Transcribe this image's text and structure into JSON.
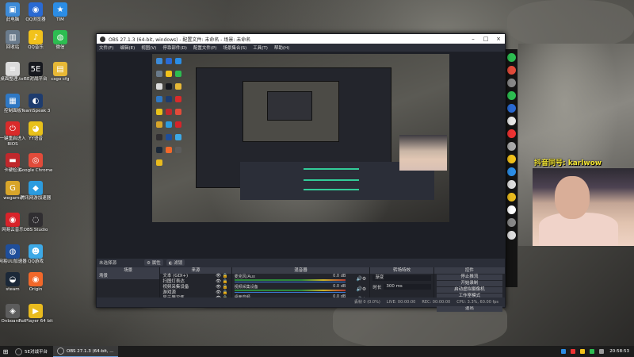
{
  "desktop": {
    "icons": [
      {
        "label": "此电脑",
        "color": "#3d8bd8",
        "glyph": "▣"
      },
      {
        "label": "QQ浏览器",
        "color": "#2a6ad3",
        "glyph": "◉"
      },
      {
        "label": "TIM",
        "color": "#2b8de5",
        "glyph": "★"
      },
      {
        "label": "回收站",
        "color": "#6a7b8c",
        "glyph": "▥"
      },
      {
        "label": "QQ音乐",
        "color": "#f2c21b",
        "glyph": "♪"
      },
      {
        "label": "微信",
        "color": "#2dbd51",
        "glyph": "◍"
      },
      {
        "label": "桌面整理.txt",
        "color": "#dcdcdc",
        "glyph": "≡"
      },
      {
        "label": "5E对战平台",
        "color": "#16181e",
        "glyph": "5E"
      },
      {
        "label": "csgo cfg",
        "color": "#e7b836",
        "glyph": "▤"
      },
      {
        "label": "控制面板",
        "color": "#2f78c4",
        "glyph": "▦"
      },
      {
        "label": "TeamSpeak 3",
        "color": "#1e3c6e",
        "glyph": "◐"
      },
      {
        "label": "一键重启进入BIOS",
        "color": "#d92b2b",
        "glyph": "⏻"
      },
      {
        "label": "YY语音",
        "color": "#e8c11a",
        "glyph": "◕"
      },
      {
        "label": "卡硬检测",
        "color": "#c0282c",
        "glyph": "▬"
      },
      {
        "label": "Google Chrome",
        "color": "#e24b3a",
        "glyph": "◎"
      },
      {
        "label": "wegame",
        "color": "#d8a52a",
        "glyph": "G"
      },
      {
        "label": "腾讯网游加速器",
        "color": "#2c9cdf",
        "glyph": "◆"
      },
      {
        "label": "网易云音乐",
        "color": "#d8232a",
        "glyph": "◉"
      },
      {
        "label": "OBS Studio",
        "color": "#302e31",
        "glyph": "◌"
      },
      {
        "label": "网易UU加速器",
        "color": "#1f4e9a",
        "glyph": "◍"
      },
      {
        "label": "QQ游戏",
        "color": "#3da9e6",
        "glyph": "☻"
      },
      {
        "label": "steam",
        "color": "#1b2838",
        "glyph": "◒"
      },
      {
        "label": "Origin",
        "color": "#f2682a",
        "glyph": "◉"
      },
      {
        "label": "Onboard...",
        "color": "#5c5c5c",
        "glyph": "◈"
      },
      {
        "label": "PotPlayer 64 bit",
        "color": "#e9bb1e",
        "glyph": "▶"
      }
    ]
  },
  "obs": {
    "title": "OBS 27.1.3 (64-bit, windows) - 配置文件: 未命名 - 场景: 未命名",
    "window_controls": [
      "–",
      "□",
      "×"
    ],
    "menu": [
      "文件(F)",
      "编辑(E)",
      "视图(V)",
      "停靠部件(D)",
      "配置文件(P)",
      "场景集合(S)",
      "工具(T)",
      "帮助(H)"
    ],
    "current_scene_label": "未选择源",
    "toolbar": {
      "props": "⚙ 属性",
      "filters": "◐ 滤镜"
    },
    "docks": {
      "scenes": {
        "title": "场景",
        "items": [
          "场景"
        ]
      },
      "sources": {
        "title": "来源",
        "items": [
          "文本 (GDI+)",
          "扫图灯表达",
          "视频采集设备",
          "游戏源",
          "显示器采集"
        ]
      },
      "mixer": {
        "title": "混音器",
        "channels": [
          {
            "name": "麦克风/Aux",
            "level": "0.0 dB"
          },
          {
            "name": "视频采集设备",
            "level": "0.0 dB"
          },
          {
            "name": "桌面音频",
            "level": "0.0 dB"
          }
        ]
      },
      "transitions": {
        "title": "转场特效",
        "type": "渐变",
        "duration_label": "时长",
        "duration": "300 ms"
      },
      "controls": {
        "title": "控件",
        "buttons": [
          "停止推流",
          "开始录制",
          "启动虚拟摄像机",
          "工作室模式",
          "设置",
          "退出"
        ]
      }
    },
    "status": {
      "dropped": "丢帧 0 (0.0%)",
      "live": "LIVE: 00:00:00",
      "rec": "REC: 00:00:00",
      "cpu": "CPU: 3.3%, 60.00 fps"
    }
  },
  "overlay": {
    "streamer_text": "抖音同号: karlwow"
  },
  "taskbar": {
    "tasks": [
      {
        "label": "5E对战平台",
        "active": false
      },
      {
        "label": "OBS 27.1.3 (64-bit, ...",
        "active": true
      }
    ],
    "time": "20:58:53"
  }
}
